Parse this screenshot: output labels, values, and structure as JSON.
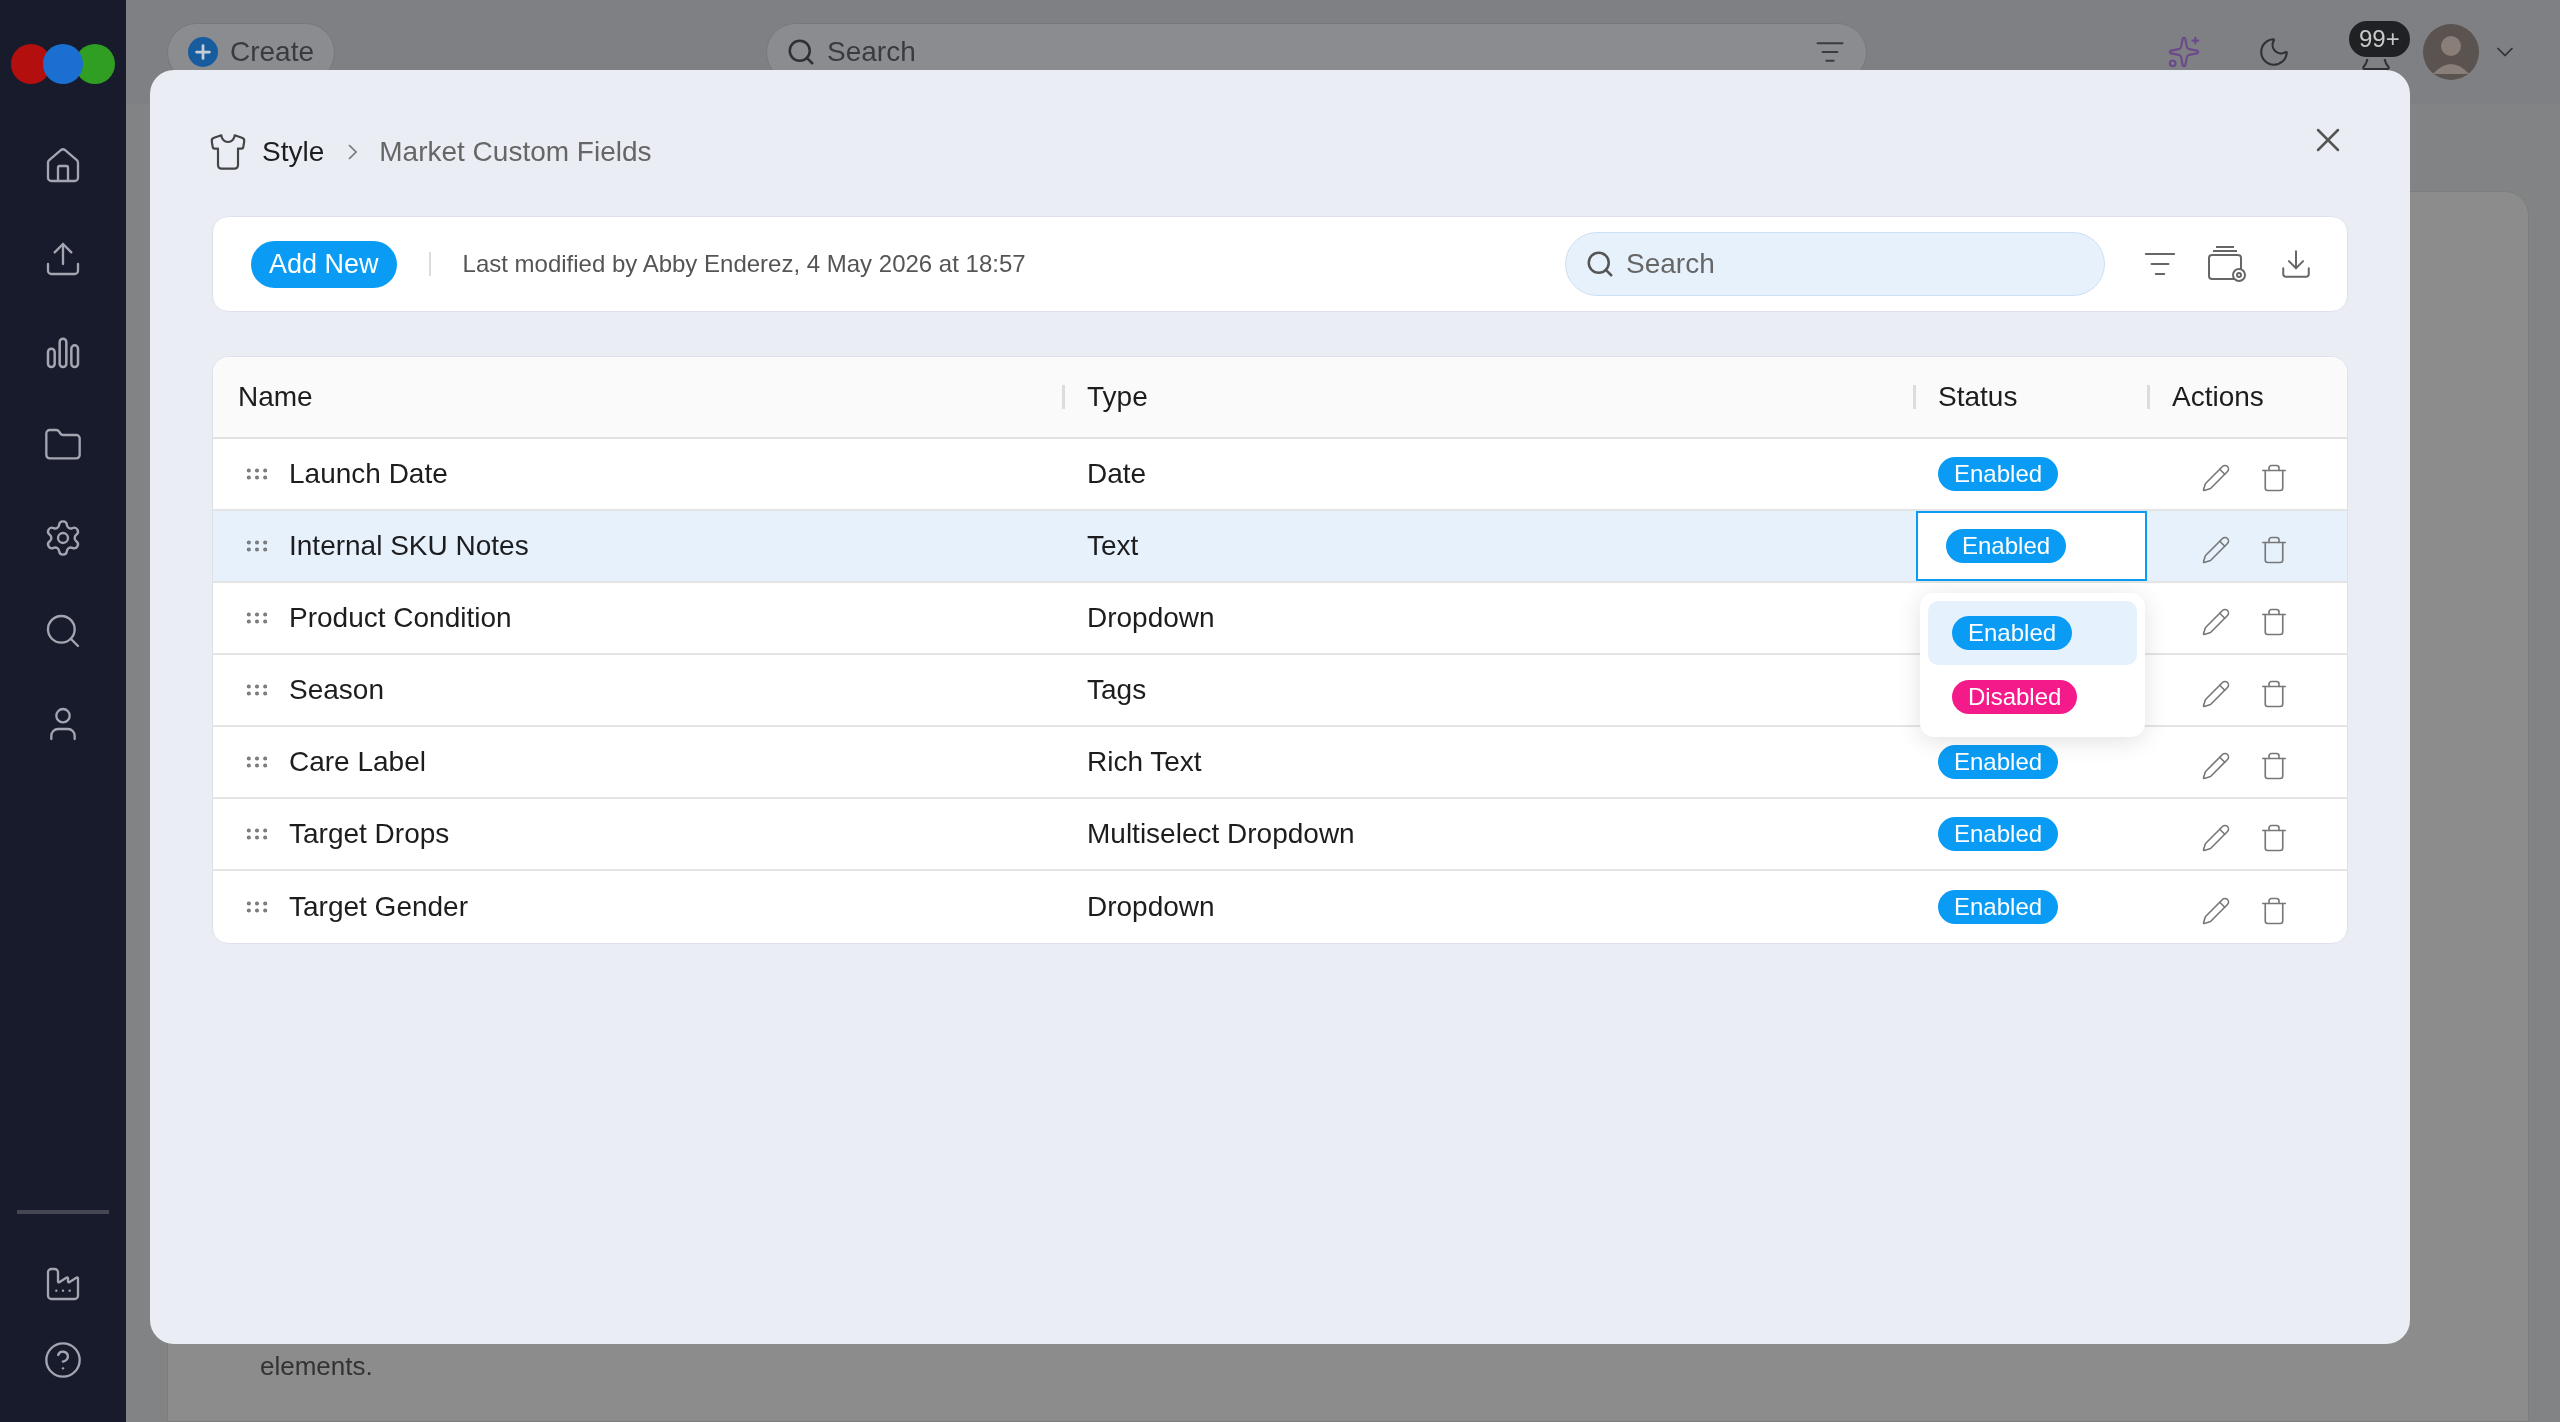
{
  "top_bar": {
    "create_button": "Create",
    "search": {
      "placeholder": "Search"
    },
    "notifications_badge": "99+"
  },
  "background": {
    "text": "elements."
  },
  "dialog": {
    "breadcrumb": [
      "Style",
      "Market Custom Fields"
    ],
    "toolbar": {
      "add_button": "Add New",
      "last_modified": "Last modified by Abby Enderez, 4 May 2026 at 18:57",
      "search": {
        "placeholder": "Search"
      }
    },
    "table": {
      "columns": [
        "Name",
        "Type",
        "Status",
        "Actions"
      ],
      "rows": [
        {
          "name": "Launch Date",
          "type": "Date",
          "status": {
            "label": "Enabled",
            "kind": "enabled"
          },
          "selected": false,
          "editing": false
        },
        {
          "name": "Internal SKU Notes",
          "type": "Text",
          "status": {
            "label": "Enabled",
            "kind": "enabled"
          },
          "selected": true,
          "editing": true
        },
        {
          "name": "Product Condition",
          "type": "Dropdown",
          "selected": false,
          "editing": false
        },
        {
          "name": "Season",
          "type": "Tags",
          "selected": false,
          "editing": false
        },
        {
          "name": "Care Label",
          "type": "Rich Text",
          "status": {
            "label": "Enabled",
            "kind": "enabled"
          },
          "selected": false,
          "editing": false
        },
        {
          "name": "Target Drops",
          "type": "Multiselect Dropdown",
          "status": {
            "label": "Enabled",
            "kind": "enabled"
          },
          "selected": false,
          "editing": false
        },
        {
          "name": "Target Gender",
          "type": "Dropdown",
          "status": {
            "label": "Enabled",
            "kind": "enabled"
          },
          "selected": false,
          "editing": false
        }
      ]
    },
    "status_menu": {
      "options": [
        {
          "label": "Enabled",
          "kind": "enabled",
          "selected": true
        },
        {
          "label": "Disabled",
          "kind": "disabled",
          "selected": false
        }
      ]
    }
  }
}
